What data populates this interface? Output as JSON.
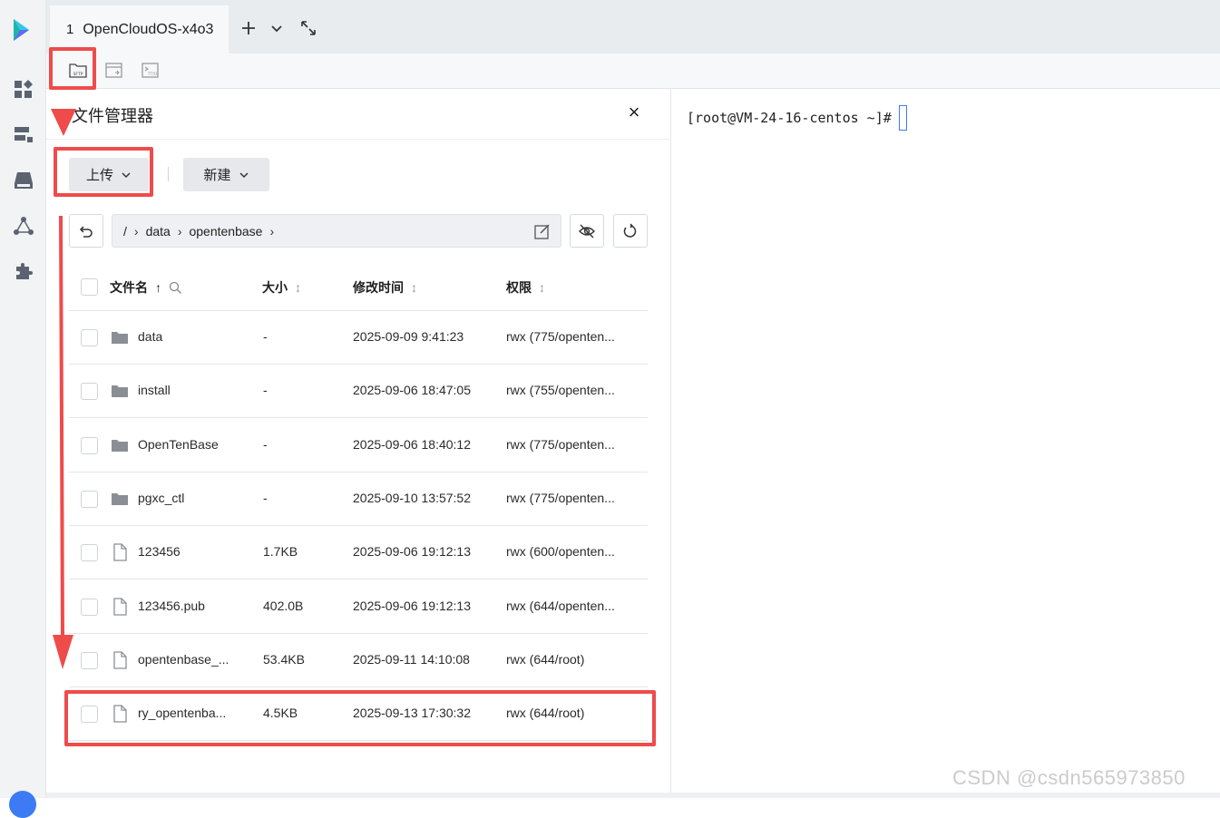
{
  "tabbar": {
    "tab_number": "1",
    "tab_title": "OpenCloudOS-x4o3"
  },
  "toolbar": {
    "sftp_label": "SFTP",
    "tool2_label": "",
    "tool3_label": "TTYD"
  },
  "file_manager": {
    "title": "文件管理器",
    "upload_label": "上传",
    "new_label": "新建",
    "path": {
      "root": "/",
      "segments": [
        "data",
        "opentenbase"
      ]
    },
    "columns": {
      "name": "文件名",
      "size": "大小",
      "mtime": "修改时间",
      "perm": "权限"
    },
    "rows": [
      {
        "type": "folder",
        "name": "data",
        "size": "-",
        "mtime": "2025-09-09 9:41:23",
        "perm": "rwx  (775/openten..."
      },
      {
        "type": "folder",
        "name": "install",
        "size": "-",
        "mtime": "2025-09-06 18:47:05",
        "perm": "rwx  (755/openten..."
      },
      {
        "type": "folder",
        "name": "OpenTenBase",
        "size": "-",
        "mtime": "2025-09-06 18:40:12",
        "perm": "rwx  (775/openten..."
      },
      {
        "type": "folder",
        "name": "pgxc_ctl",
        "size": "-",
        "mtime": "2025-09-10 13:57:52",
        "perm": "rwx  (775/openten..."
      },
      {
        "type": "file",
        "name": "123456",
        "size": "1.7KB",
        "mtime": "2025-09-06 19:12:13",
        "perm": "rwx  (600/openten..."
      },
      {
        "type": "file",
        "name": "123456.pub",
        "size": "402.0B",
        "mtime": "2025-09-06 19:12:13",
        "perm": "rwx  (644/openten..."
      },
      {
        "type": "file",
        "name": "opentenbase_...",
        "size": "53.4KB",
        "mtime": "2025-09-11 14:10:08",
        "perm": "rwx  (644/root)"
      },
      {
        "type": "file",
        "name": "ry_opentenba...",
        "size": "4.5KB",
        "mtime": "2025-09-13 17:30:32",
        "perm": "rwx  (644/root)"
      }
    ]
  },
  "terminal": {
    "prompt": "[root@VM-24-16-centos ~]#"
  },
  "watermark": "CSDN @csdn565973850",
  "colors": {
    "annotation_red": "#ef4b4b",
    "cursor_blue": "#3d7bf5"
  }
}
